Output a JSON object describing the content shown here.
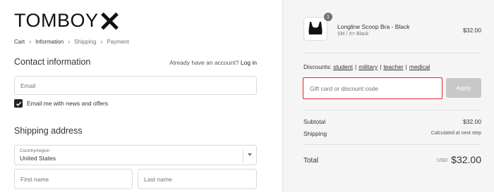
{
  "brand": {
    "name": "TOMBOY"
  },
  "breadcrumb": [
    {
      "label": "Cart"
    },
    {
      "label": "Information"
    },
    {
      "label": "Shipping"
    },
    {
      "label": "Payment"
    }
  ],
  "contact": {
    "title": "Contact information",
    "login_prompt": "Already have an account?",
    "login_link": "Log in",
    "email_placeholder": "Email",
    "newsletter_label": "Email me with news and offers",
    "newsletter_checked": true
  },
  "shipping": {
    "title": "Shipping address",
    "country_label": "Country/region",
    "country_value": "United States",
    "first_name_placeholder": "First name",
    "last_name_placeholder": "Last name"
  },
  "order": {
    "item": {
      "name": "Longline Scoop Bra - Black",
      "variant": "SM / X= Black",
      "price": "$32.00",
      "quantity": "1"
    },
    "discounts_label": "Discounts:",
    "discount_links": [
      "student",
      "military",
      "teacher",
      "medical"
    ],
    "gift_placeholder": "Gift card or discount code",
    "apply_label": "Apply",
    "subtotal_label": "Subtotal",
    "subtotal_value": "$32.00",
    "shipping_label": "Shipping",
    "shipping_value": "Calculated at next step",
    "total_label": "Total",
    "total_currency": "USD",
    "total_value": "$32.00"
  },
  "colors": {
    "highlight_border": "#e0262b",
    "right_panel_bg": "#f5f5f5"
  }
}
